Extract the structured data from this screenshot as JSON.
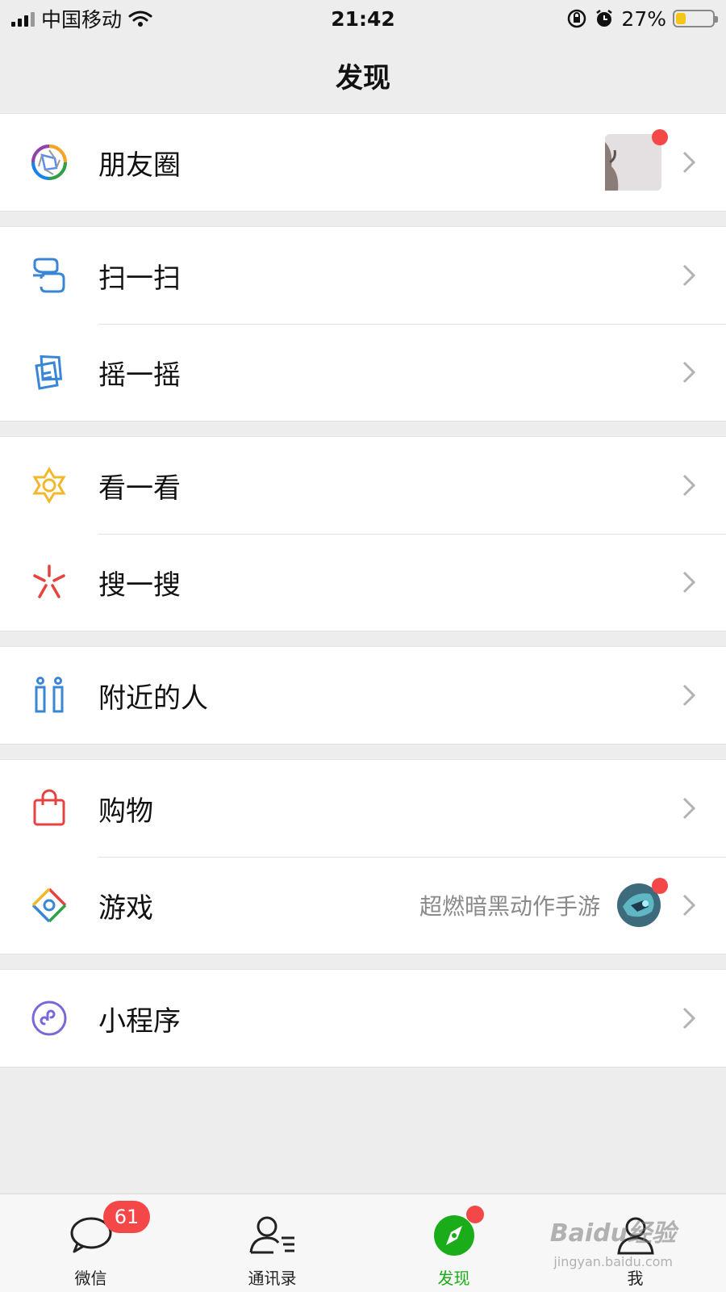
{
  "status_bar": {
    "carrier": "中国移动",
    "time": "21:42",
    "battery": "27%",
    "battery_level": 0.27,
    "battery_color": "#f5c518"
  },
  "title": "发现",
  "menu": {
    "moments": {
      "label": "朋友圈",
      "icon": "moments-icon"
    },
    "scan": {
      "label": "扫一扫",
      "icon": "scan-icon"
    },
    "shake": {
      "label": "摇一摇",
      "icon": "shake-icon"
    },
    "top_stories": {
      "label": "看一看",
      "icon": "top-stories-icon"
    },
    "search": {
      "label": "搜一搜",
      "icon": "search-icon"
    },
    "people_nearby": {
      "label": "附近的人",
      "icon": "people-nearby-icon"
    },
    "shopping": {
      "label": "购物",
      "icon": "shopping-bag-icon"
    },
    "games": {
      "label": "游戏",
      "subtitle": "超燃暗黑动作手游",
      "icon": "games-icon"
    },
    "mini_programs": {
      "label": "小程序",
      "icon": "mini-program-icon"
    }
  },
  "tabbar": {
    "chats": {
      "label": "微信",
      "badge": "61"
    },
    "contacts": {
      "label": "通讯录"
    },
    "discover": {
      "label": "发现"
    },
    "me": {
      "label": "我"
    }
  },
  "colors": {
    "accent": "#1aad19",
    "badge": "#f44848",
    "background": "#ededed"
  },
  "watermark": {
    "brand": "Baidu经验",
    "url": "jingyan.baidu.com"
  }
}
